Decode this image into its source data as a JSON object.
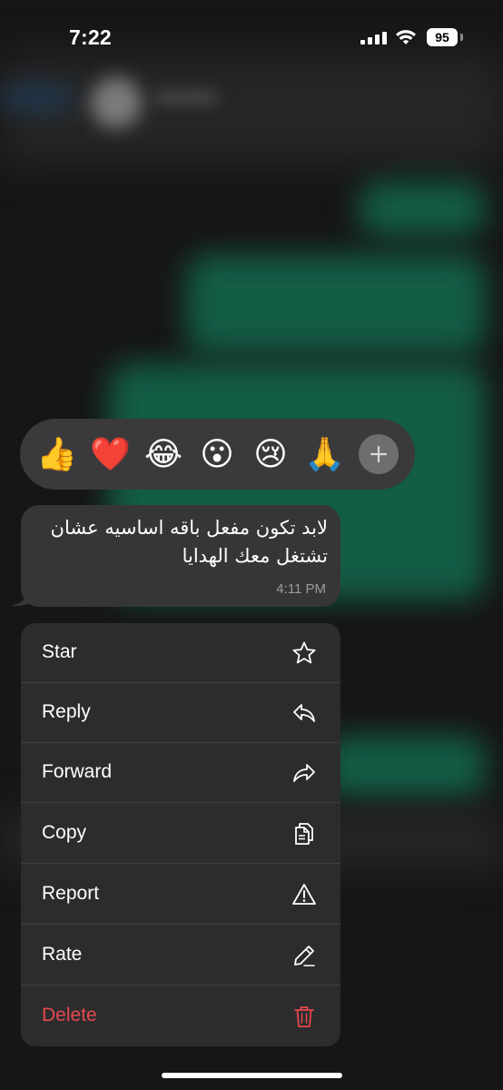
{
  "status_bar": {
    "time": "7:22",
    "battery": "95"
  },
  "reactions": [
    "👍",
    "❤️",
    "😂",
    "😮",
    "😢",
    "🙏"
  ],
  "message": {
    "line1": "لابد تكون مفعل باقه اساسيه عشان",
    "line2": "تشتغل معك الهدايا",
    "time": "4:11 PM"
  },
  "menu": {
    "star": "Star",
    "reply": "Reply",
    "forward": "Forward",
    "copy": "Copy",
    "report": "Report",
    "rate": "Rate",
    "delete": "Delete"
  },
  "colors": {
    "destructive": "#e5484d",
    "menu_bg": "#2c2c2e",
    "bubble_bg": "#363638",
    "reaction_bar_bg": "#3a3a3c",
    "chat_green": "#135c46"
  },
  "icons": {
    "star": "star-icon",
    "reply": "reply-icon",
    "forward": "forward-icon",
    "copy": "copy-icon",
    "report": "warning-icon",
    "rate": "pencil-icon",
    "delete": "trash-icon",
    "add_reaction": "plus-icon"
  }
}
